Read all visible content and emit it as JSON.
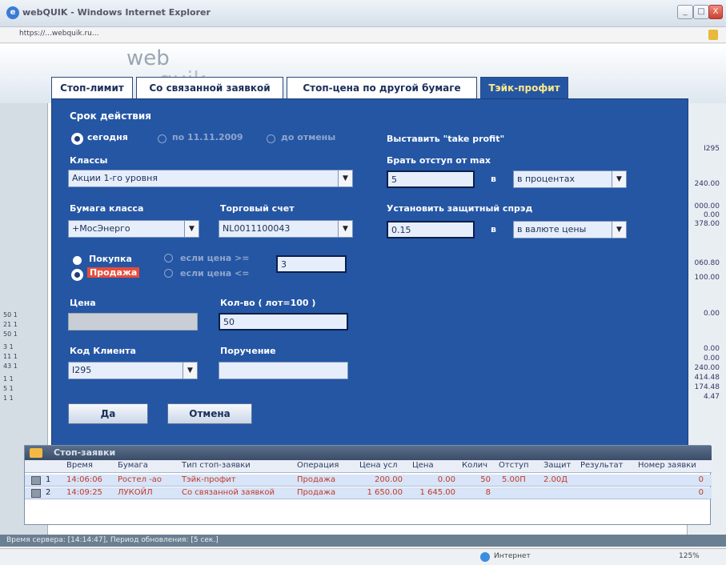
{
  "window": {
    "title": "webQUIK - Windows Internet Explorer",
    "minimize": "_",
    "maximize": "□",
    "close": "X"
  },
  "address": {
    "url": "https://...webquik.ru..."
  },
  "tabs": [
    "Стоп-лимит",
    "Со связанной заявкой",
    "Стоп-цена по другой бумаге",
    "Тэйк-профит"
  ],
  "form": {
    "validity_label": "Срок действия",
    "validity_options": [
      "сегодня",
      "по 11.11.2009",
      "до отмены"
    ],
    "classes_label": "Классы",
    "classes_value": "Акции 1-го уровня",
    "security_label": "Бумага класса",
    "security_value": "+МосЭнерго",
    "account_label": "Торговый счет",
    "account_value": "NL0011100043",
    "buy_label": "Покупка",
    "sell_label": "Продажа",
    "cond_ge": "если цена >=",
    "cond_le": "если цена <=",
    "cond_value": "3",
    "price_label": "Цена",
    "price_value": "",
    "qty_label": "Кол-во ( лот=100 )",
    "qty_value": "50",
    "client_label": "Код Клиента",
    "client_value": "I295",
    "instruction_label": "Поручение",
    "instruction_value": "",
    "ok_button": "Да",
    "cancel_button": "Отмена",
    "tp_title": "Выставить \"take profit\"",
    "offset_label": "Брать отступ от max",
    "offset_value": "5",
    "in_label": "в",
    "offset_unit": "в процентах",
    "spread_label": "Установить защитный спрэд",
    "spread_value": "0.15",
    "spread_unit": "в валюте цены"
  },
  "stop_orders": {
    "title": "Стоп-заявки",
    "columns": [
      "Время",
      "Бумага",
      "Тип стоп-заявки",
      "Операция",
      "Цена усл",
      "Цена",
      "Колич",
      "Отступ",
      "Защит",
      "Результат",
      "Номер заявки"
    ],
    "rows": [
      {
        "n": "1",
        "time": "14:06:06",
        "sec": "Ростел -ао",
        "type": "Тэйк-профит",
        "op": "Продажа",
        "cond_price": "200.00",
        "price": "0.00",
        "qty": "50",
        "offset": "5.00П",
        "spread": "2.00Д",
        "result": "",
        "order_no": "0"
      },
      {
        "n": "2",
        "time": "14:09:25",
        "sec": "ЛУКОЙЛ",
        "type": "Со связанной заявкой",
        "op": "Продажа",
        "cond_price": "1 650.00",
        "price": "1 645.00",
        "qty": "8",
        "offset": "",
        "spread": "",
        "result": "",
        "order_no": "0"
      }
    ]
  },
  "right_values": [
    "I295",
    "240.00",
    "000.00",
    "0.00",
    "378.00",
    "060.80",
    "100.00",
    "0.00",
    "0.00",
    "0.00",
    "240.00",
    "414.48",
    "174.48",
    "4.47"
  ],
  "status": {
    "server_time": "Время сервера: [14:14:47], Период обновления: [5 сек.]",
    "zone": "Интернет",
    "zoom": "125%"
  }
}
